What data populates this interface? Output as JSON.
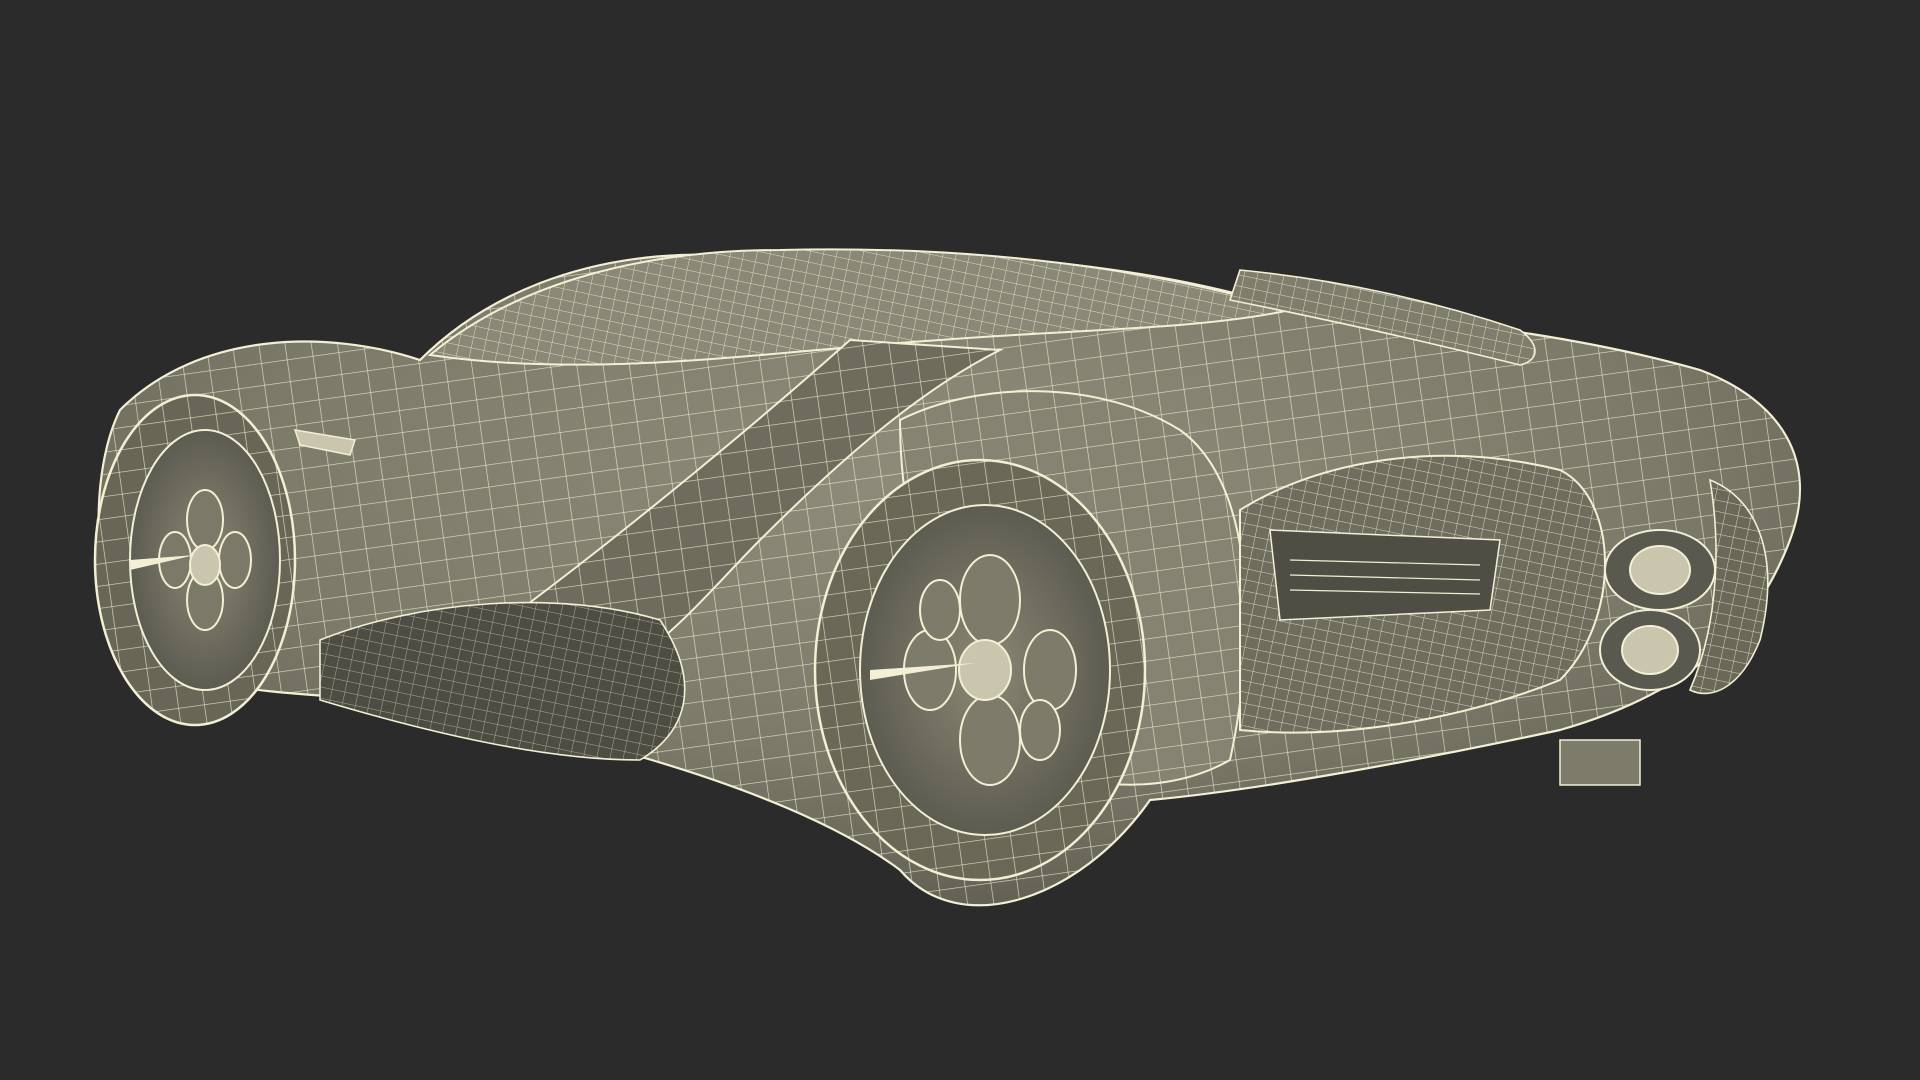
{
  "scene": {
    "subject": "wireframe-sports-car",
    "background_color": "#2b2b2b",
    "mesh_fill_color": "#7c7a69",
    "mesh_fill_shadow": "#5d5c4f",
    "mesh_fill_highlight": "#8e8c7a",
    "wire_color": "#f2efd4"
  }
}
